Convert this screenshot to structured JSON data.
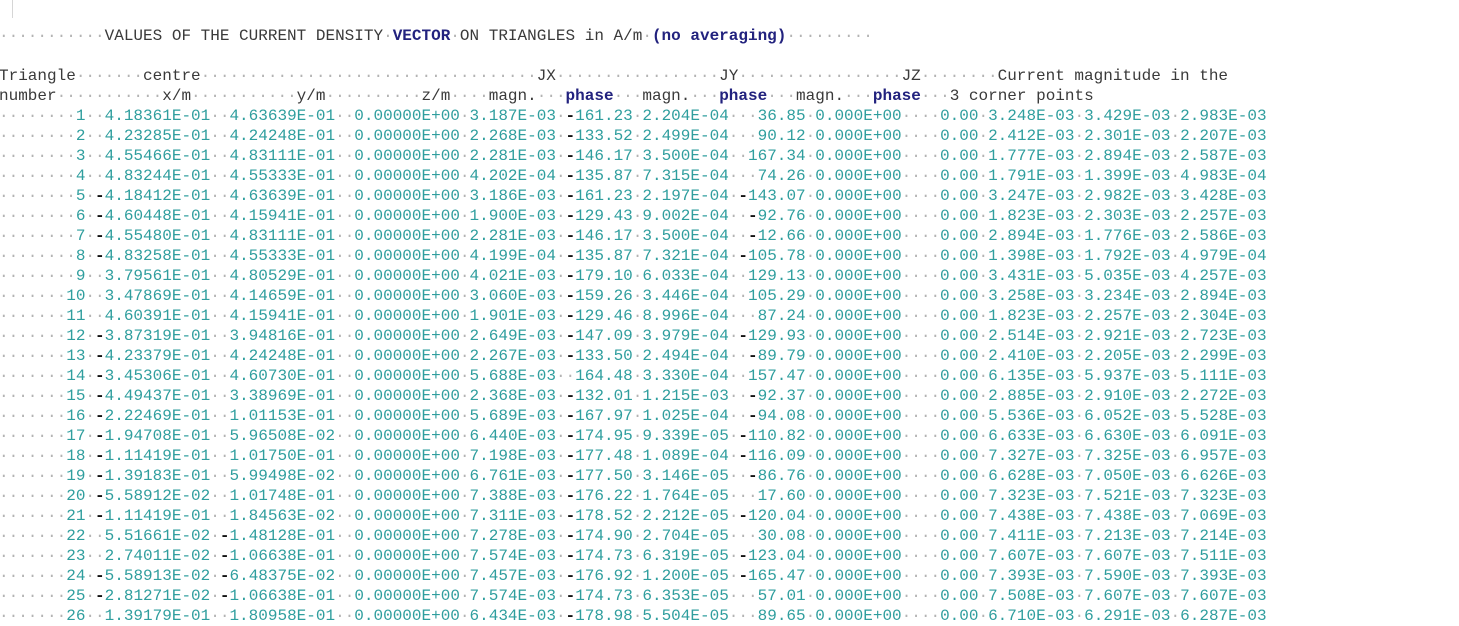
{
  "title": {
    "prefix": "VALUES OF THE CURRENT DENSITY",
    "keyword": "VECTOR",
    "suffix": "ON TRIANGLES in A/m",
    "note": "(no averaging)"
  },
  "header": {
    "row1": {
      "triangle": "Triangle",
      "centre": "centre",
      "jx": "JX",
      "jy": "JY",
      "jz": "JZ",
      "current": "Current magnitude in the"
    },
    "row2": {
      "number": "number",
      "x": "x/m",
      "y": "y/m",
      "z": "z/m",
      "magn": "magn.",
      "phase": "phase",
      "corner": "3 corner points"
    }
  },
  "rows": [
    [
      "1",
      "4.18361E-01",
      "4.63639E-01",
      "0.00000E+00",
      "3.187E-03",
      "-161.23",
      "2.204E-04",
      "36.85",
      "0.000E+00",
      "0.00",
      "3.248E-03",
      "3.429E-03",
      "2.983E-03"
    ],
    [
      "2",
      "4.23285E-01",
      "4.24248E-01",
      "0.00000E+00",
      "2.268E-03",
      "-133.52",
      "2.499E-04",
      "90.12",
      "0.000E+00",
      "0.00",
      "2.412E-03",
      "2.301E-03",
      "2.207E-03"
    ],
    [
      "3",
      "4.55466E-01",
      "4.83111E-01",
      "0.00000E+00",
      "2.281E-03",
      "-146.17",
      "3.500E-04",
      "167.34",
      "0.000E+00",
      "0.00",
      "1.777E-03",
      "2.894E-03",
      "2.587E-03"
    ],
    [
      "4",
      "4.83244E-01",
      "4.55333E-01",
      "0.00000E+00",
      "4.202E-04",
      "-135.87",
      "7.315E-04",
      "74.26",
      "0.000E+00",
      "0.00",
      "1.791E-03",
      "1.399E-03",
      "4.983E-04"
    ],
    [
      "5",
      "-4.18412E-01",
      "4.63639E-01",
      "0.00000E+00",
      "3.186E-03",
      "-161.23",
      "2.197E-04",
      "-143.07",
      "0.000E+00",
      "0.00",
      "3.247E-03",
      "2.982E-03",
      "3.428E-03"
    ],
    [
      "6",
      "-4.60448E-01",
      "4.15941E-01",
      "0.00000E+00",
      "1.900E-03",
      "-129.43",
      "9.002E-04",
      "-92.76",
      "0.000E+00",
      "0.00",
      "1.823E-03",
      "2.303E-03",
      "2.257E-03"
    ],
    [
      "7",
      "-4.55480E-01",
      "4.83111E-01",
      "0.00000E+00",
      "2.281E-03",
      "-146.17",
      "3.500E-04",
      "-12.66",
      "0.000E+00",
      "0.00",
      "2.894E-03",
      "1.776E-03",
      "2.586E-03"
    ],
    [
      "8",
      "-4.83258E-01",
      "4.55333E-01",
      "0.00000E+00",
      "4.199E-04",
      "-135.87",
      "7.321E-04",
      "-105.78",
      "0.000E+00",
      "0.00",
      "1.398E-03",
      "1.792E-03",
      "4.979E-04"
    ],
    [
      "9",
      "3.79561E-01",
      "4.80529E-01",
      "0.00000E+00",
      "4.021E-03",
      "-179.10",
      "6.033E-04",
      "129.13",
      "0.000E+00",
      "0.00",
      "3.431E-03",
      "5.035E-03",
      "4.257E-03"
    ],
    [
      "10",
      "3.47869E-01",
      "4.14659E-01",
      "0.00000E+00",
      "3.060E-03",
      "-159.26",
      "3.446E-04",
      "105.29",
      "0.000E+00",
      "0.00",
      "3.258E-03",
      "3.234E-03",
      "2.894E-03"
    ],
    [
      "11",
      "4.60391E-01",
      "4.15941E-01",
      "0.00000E+00",
      "1.901E-03",
      "-129.46",
      "8.996E-04",
      "87.24",
      "0.000E+00",
      "0.00",
      "1.823E-03",
      "2.257E-03",
      "2.304E-03"
    ],
    [
      "12",
      "-3.87319E-01",
      "3.94816E-01",
      "0.00000E+00",
      "2.649E-03",
      "-147.09",
      "3.979E-04",
      "-129.93",
      "0.000E+00",
      "0.00",
      "2.514E-03",
      "2.921E-03",
      "2.723E-03"
    ],
    [
      "13",
      "-4.23379E-01",
      "4.24248E-01",
      "0.00000E+00",
      "2.267E-03",
      "-133.50",
      "2.494E-04",
      "-89.79",
      "0.000E+00",
      "0.00",
      "2.410E-03",
      "2.205E-03",
      "2.299E-03"
    ],
    [
      "14",
      "-3.45306E-01",
      "4.60730E-01",
      "0.00000E+00",
      "5.688E-03",
      "164.48",
      "3.330E-04",
      "157.47",
      "0.000E+00",
      "0.00",
      "6.135E-03",
      "5.937E-03",
      "5.111E-03"
    ],
    [
      "15",
      "-4.49437E-01",
      "3.38969E-01",
      "0.00000E+00",
      "2.368E-03",
      "-132.01",
      "1.215E-03",
      "-92.37",
      "0.000E+00",
      "0.00",
      "2.885E-03",
      "2.910E-03",
      "2.272E-03"
    ],
    [
      "16",
      "-2.22469E-01",
      "1.01153E-01",
      "0.00000E+00",
      "5.689E-03",
      "-167.97",
      "1.025E-04",
      "-94.08",
      "0.000E+00",
      "0.00",
      "5.536E-03",
      "6.052E-03",
      "5.528E-03"
    ],
    [
      "17",
      "-1.94708E-01",
      "5.96508E-02",
      "0.00000E+00",
      "6.440E-03",
      "-174.95",
      "9.339E-05",
      "-110.82",
      "0.000E+00",
      "0.00",
      "6.633E-03",
      "6.630E-03",
      "6.091E-03"
    ],
    [
      "18",
      "-1.11419E-01",
      "1.01750E-01",
      "0.00000E+00",
      "7.198E-03",
      "-177.48",
      "1.089E-04",
      "-116.09",
      "0.000E+00",
      "0.00",
      "7.327E-03",
      "7.325E-03",
      "6.957E-03"
    ],
    [
      "19",
      "-1.39183E-01",
      "5.99498E-02",
      "0.00000E+00",
      "6.761E-03",
      "-177.50",
      "3.146E-05",
      "-86.76",
      "0.000E+00",
      "0.00",
      "6.628E-03",
      "7.050E-03",
      "6.626E-03"
    ],
    [
      "20",
      "-5.58912E-02",
      "1.01748E-01",
      "0.00000E+00",
      "7.388E-03",
      "-176.22",
      "1.764E-05",
      "17.60",
      "0.000E+00",
      "0.00",
      "7.323E-03",
      "7.521E-03",
      "7.323E-03"
    ],
    [
      "21",
      "-1.11419E-01",
      "1.84563E-02",
      "0.00000E+00",
      "7.311E-03",
      "-178.52",
      "2.212E-05",
      "-120.04",
      "0.000E+00",
      "0.00",
      "7.438E-03",
      "7.438E-03",
      "7.069E-03"
    ],
    [
      "22",
      "5.51661E-02",
      "-1.48128E-01",
      "0.00000E+00",
      "7.278E-03",
      "-174.90",
      "2.704E-05",
      "30.08",
      "0.000E+00",
      "0.00",
      "7.411E-03",
      "7.213E-03",
      "7.214E-03"
    ],
    [
      "23",
      "2.74011E-02",
      "-1.06638E-01",
      "0.00000E+00",
      "7.574E-03",
      "-174.73",
      "6.319E-05",
      "-123.04",
      "0.000E+00",
      "0.00",
      "7.607E-03",
      "7.607E-03",
      "7.511E-03"
    ],
    [
      "24",
      "-5.58913E-02",
      "-6.48375E-02",
      "0.00000E+00",
      "7.457E-03",
      "-176.92",
      "1.200E-05",
      "-165.47",
      "0.000E+00",
      "0.00",
      "7.393E-03",
      "7.590E-03",
      "7.393E-03"
    ],
    [
      "25",
      "-2.81271E-02",
      "-1.06638E-01",
      "0.00000E+00",
      "7.574E-03",
      "-174.73",
      "6.353E-05",
      "57.01",
      "0.000E+00",
      "0.00",
      "7.508E-03",
      "7.607E-03",
      "7.607E-03"
    ],
    [
      "26",
      "1.39179E-01",
      "1.80958E-01",
      "0.00000E+00",
      "6.434E-03",
      "-178.98",
      "5.504E-05",
      "89.65",
      "0.000E+00",
      "0.00",
      "6.710E-03",
      "6.291E-03",
      "6.287E-03"
    ]
  ]
}
